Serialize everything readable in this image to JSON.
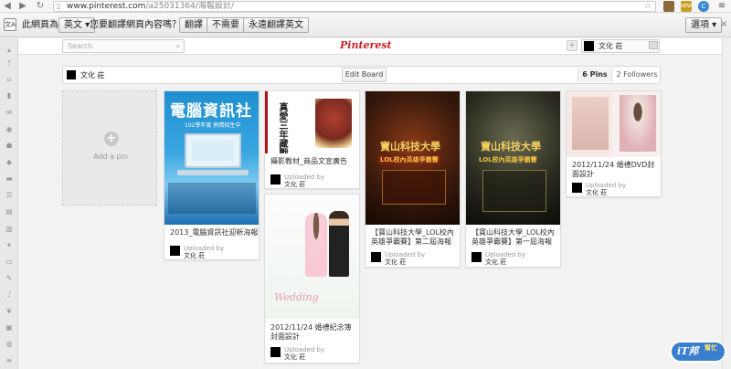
{
  "browser": {
    "url_host": "www.pinterest.com",
    "url_path": "/a25031364/海報設計/",
    "extension_badge": "NEW"
  },
  "translate_bar": {
    "label_this_page_is": "此網頁為",
    "language_value": "英文",
    "question": "您要翻譯網頁內容嗎？",
    "translate_button": "翻譯",
    "nope_button": "不需要",
    "never_button": "永遠翻譯英文",
    "options_button": "選項"
  },
  "header": {
    "search_placeholder": "Search",
    "logo": "Pinterest",
    "add_button": "+",
    "user_name": "文化 莊"
  },
  "board": {
    "owner_name": "文化 莊",
    "edit_button": "Edit Board",
    "pins_count": "6 Pins",
    "followers_count": "2 Followers"
  },
  "add_pin": {
    "label": "Add a pin"
  },
  "pins": [
    {
      "description": "2013_電腦資訊社迎新海報",
      "uploaded_by": "Uploaded by",
      "user": "文化 莊",
      "image_title": "電腦資訊社",
      "image_subtitle": "102學年度 熱情招生中"
    },
    {
      "description": "攝影教材_商品文宣廣告",
      "uploaded_by": "Uploaded by",
      "user": "文化 莊",
      "image_title": "真愛三年藏戰"
    },
    {
      "description": "2012/11/24 婚禮紀念簿封面設計",
      "uploaded_by": "Uploaded by",
      "user": "文化 莊",
      "image_title": "Wedding"
    },
    {
      "description": "【寶山科技大學_LOL校內英雄爭霸賽】第二屆海報",
      "uploaded_by": "Uploaded by",
      "user": "文化 莊",
      "image_title": "寶山科技大學",
      "image_subtitle": "LOL校內英雄爭霸賽"
    },
    {
      "description": "【寶山科技大學_LOL校內英雄爭霸賽】第一屆海報",
      "uploaded_by": "Uploaded by",
      "user": "文化 莊",
      "image_title": "寶山科技大學",
      "image_subtitle": "LOL校內英雄爭霸賽"
    },
    {
      "description": "2012/11/24 婚禮DVD封面設計",
      "uploaded_by": "Uploaded by",
      "user": "文化 莊"
    }
  ],
  "watermark": {
    "text_main": "iT邦",
    "text_sub": "幫忙"
  },
  "colors": {
    "pinterest_red": "#cb2027",
    "computer_poster_blue": "#1f8fd0",
    "lol_poster_dark": "#3a1a0c",
    "page_background": "#f2f2f2"
  }
}
